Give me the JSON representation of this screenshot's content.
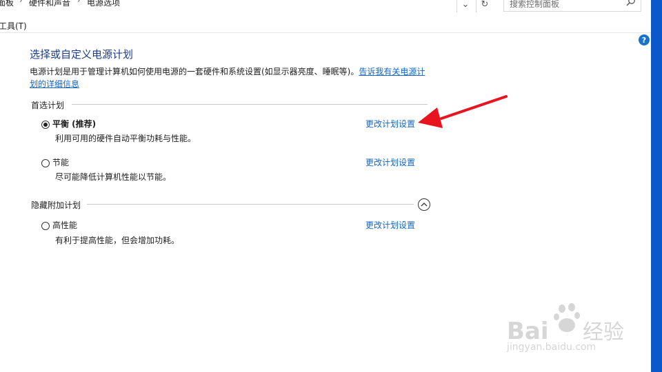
{
  "breadcrumb": {
    "items": [
      "面板",
      "硬件和声音",
      "电源选项"
    ]
  },
  "search": {
    "placeholder": "搜索控制面板"
  },
  "menu": {
    "tools_label": "工具(T)"
  },
  "help_label": "?",
  "main": {
    "title": "选择或自定义电源计划",
    "description": "电源计划是用于管理计算机如何使用电源的一套硬件和系统设置(如显示器亮度、睡眠等)。",
    "description_link": "告诉我有关电源计划的详细信息"
  },
  "preferred": {
    "label": "首选计划",
    "plans": [
      {
        "name": "平衡 (推荐)",
        "desc": "利用可用的硬件自动平衡功耗与性能。",
        "selected": true,
        "link": "更改计划设置"
      },
      {
        "name": "节能",
        "desc": "尽可能降低计算机性能以节能。",
        "selected": false,
        "link": "更改计划设置"
      }
    ]
  },
  "hidden": {
    "label": "隐藏附加计划",
    "plans": [
      {
        "name": "高性能",
        "desc": "有利于提高性能，但会增加功耗。",
        "selected": false,
        "link": "更改计划设置"
      }
    ]
  },
  "watermark": {
    "brand": "Baidu 经验",
    "url": "jingyan.baidu.com"
  },
  "colors": {
    "link": "#1565c0",
    "title": "#1a3c8a",
    "edge": "#0a58c9",
    "arrow": "#e8141e"
  }
}
